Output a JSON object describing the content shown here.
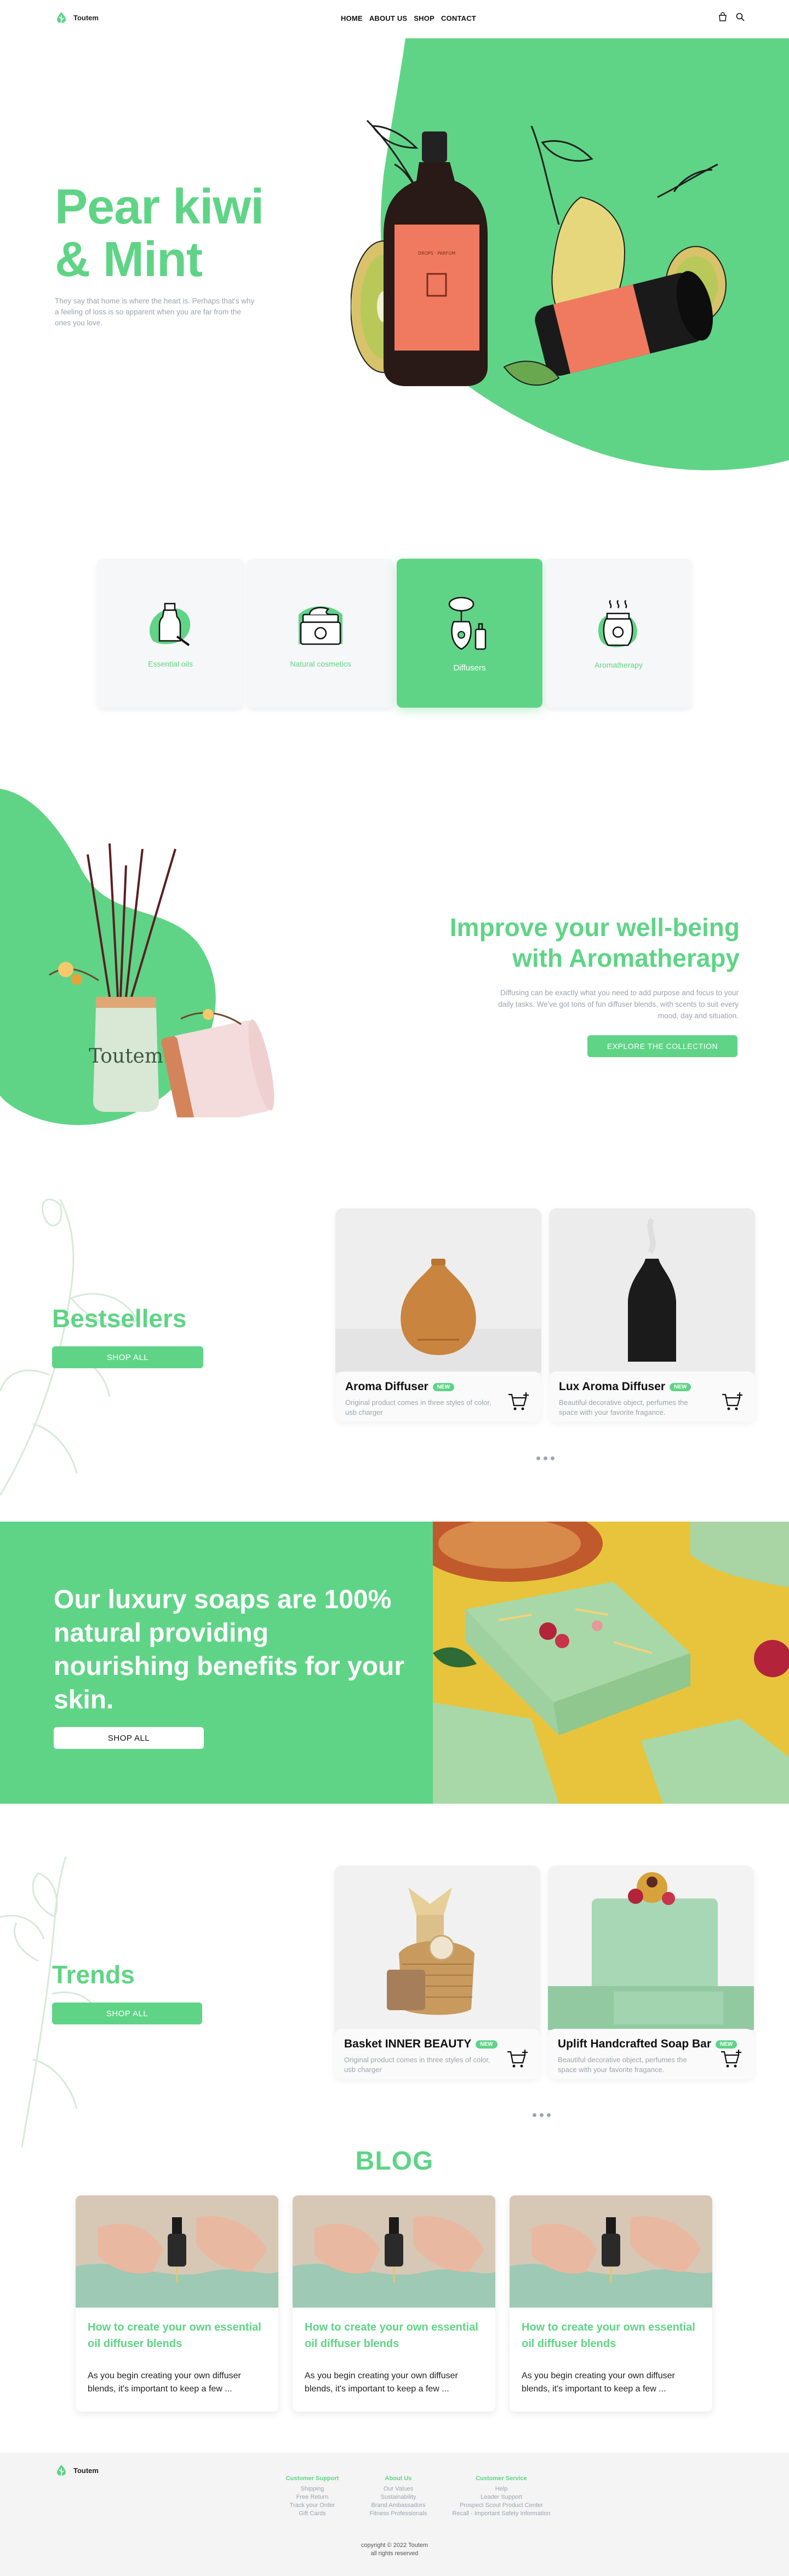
{
  "header": {
    "brand": "Toutem",
    "nav": [
      "HOME",
      "ABOUT US",
      "SHOP",
      "CONTACT"
    ]
  },
  "hero": {
    "title_line1": "Pear kiwi",
    "title_line2": "& Mint",
    "text": "They say that home is where the heart is. Perhaps that's why a feeling of loss is so apparent when you are far from the ones you love."
  },
  "categories": [
    {
      "label": "Essential oils",
      "icon": "oil-bottle-icon"
    },
    {
      "label": "Natural cosmetics",
      "icon": "cream-jar-icon"
    },
    {
      "label": "Diffusers",
      "icon": "diffuser-icon",
      "active": true
    },
    {
      "label": "Aromatherapy",
      "icon": "candle-icon"
    }
  ],
  "aroma": {
    "title_line1": "Improve your well-being",
    "title_line2": "with Aromatherapy",
    "text": "Diffusing can be exactly what you need to add purpose and focus to your daily tasks. We've got tons of fun diffuser blends, with scents to suit every mood, day and situation.",
    "button": "EXPLORE THE COLLECTION",
    "jar_label": "Toutem"
  },
  "bestsellers": {
    "title": "Bestsellers",
    "button": "SHOP ALL",
    "products": [
      {
        "name": "Aroma Diffuser",
        "badge": "NEW",
        "desc": "Original product comes in three styles of color, usb charger"
      },
      {
        "name": "Lux Aroma Diffuser",
        "badge": "NEW",
        "desc": "Beautiful decorative object, perfumes the space with your favorite fragance."
      }
    ]
  },
  "soap": {
    "title": "Our luxury soaps are 100% natural providing nourishing benefits for your skin.",
    "button": "SHOP ALL"
  },
  "trends": {
    "title": "Trends",
    "button": "SHOP ALL",
    "products": [
      {
        "name": "Basket INNER BEAUTY",
        "badge": "NEW",
        "desc": "Original product comes in three styles of color, usb charger"
      },
      {
        "name": "Uplift Handcrafted Soap Bar",
        "badge": "NEW",
        "desc": "Beautiful decorative object, perfumes the space with your favorite fragance."
      }
    ]
  },
  "blog": {
    "title": "BLOG",
    "posts": [
      {
        "title": "How to create your own essential oil diffuser blends",
        "excerpt": "As you begin creating your own diffuser blends, it's important to keep a few ..."
      },
      {
        "title": "How to create your own essential oil diffuser blends",
        "excerpt": "As you begin creating your own diffuser blends, it's important to keep a few ..."
      },
      {
        "title": "How to create your own essential oil diffuser blends",
        "excerpt": "As you begin creating your own diffuser blends, it's important to keep a few ..."
      }
    ]
  },
  "footer": {
    "brand": "Toutem",
    "columns": [
      {
        "heading": "Customer Support",
        "links": [
          "Shipping",
          "Free Return",
          "Track your Order",
          "Gift Cards"
        ]
      },
      {
        "heading": "About Us",
        "links": [
          "Our Values",
          "Sustainability",
          "Brand Ambassadors",
          "Fitness Professionals"
        ]
      },
      {
        "heading": "Customer Service",
        "links": [
          "Help",
          "Leader Support",
          "Prospect Scout Product Center",
          "Recall - Important Safety Information"
        ]
      }
    ],
    "copyright_line1": "copyright © 2022 Toutem",
    "copyright_line2": "all rights reserved"
  },
  "colors": {
    "accent": "#5fd486",
    "muted": "#9ca3af",
    "footer_bg": "#f4f4f4"
  }
}
